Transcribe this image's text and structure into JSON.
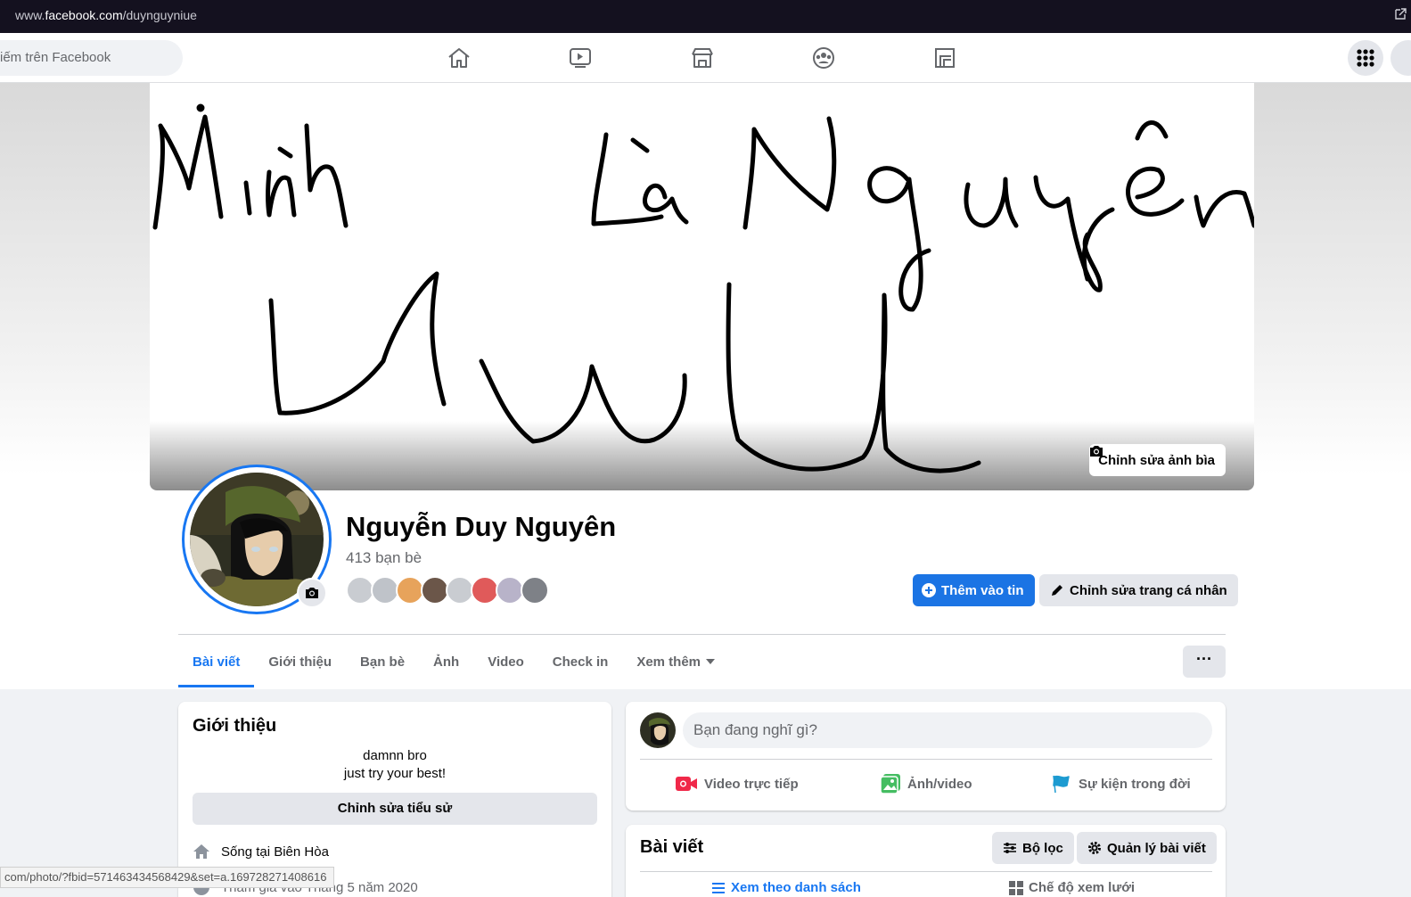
{
  "browser": {
    "url_prefix": "www.",
    "url_domain": "facebook.com",
    "url_path": "/duynguyniue",
    "status_link": "com/photo/?fbid=571463434568429&set=a.169728271408616"
  },
  "topnav": {
    "search_placeholder": "iếm trên Facebook"
  },
  "cover": {
    "edit_label": "Chỉnh sửa ảnh bìa"
  },
  "profile": {
    "name": "Nguyễn Duy Nguyên",
    "friends_count": "413 bạn bè",
    "add_story": "Thêm vào tin",
    "edit_profile": "Chỉnh sửa trang cá nhân"
  },
  "tabs": {
    "posts": "Bài viết",
    "about": "Giới thiệu",
    "friends": "Bạn bè",
    "photos": "Ảnh",
    "video": "Video",
    "checkin": "Check in",
    "more": "Xem thêm",
    "more_menu": "···"
  },
  "intro": {
    "title": "Giới thiệu",
    "bio_line1": "damnn bro",
    "bio_line2": "just try your best!",
    "edit_bio": "Chỉnh sửa tiểu sử",
    "lives_in": "Sống tại Biên Hòa",
    "joined": "Tham gia vào Tháng 5 năm 2020"
  },
  "composer": {
    "placeholder": "Bạn đang nghĩ gì?",
    "live_video": "Video trực tiếp",
    "photo_video": "Ảnh/video",
    "life_event": "Sự kiện trong đời"
  },
  "posts": {
    "title": "Bài viết",
    "filter": "Bộ lọc",
    "manage": "Quản lý bài viết",
    "list_view": "Xem theo danh sách",
    "grid_view": "Chế độ xem lưới"
  },
  "colors": {
    "accent": "#1877f2",
    "live_red": "#f02849",
    "photo_green": "#45bd62",
    "event_blue": "#1d9bd1"
  }
}
